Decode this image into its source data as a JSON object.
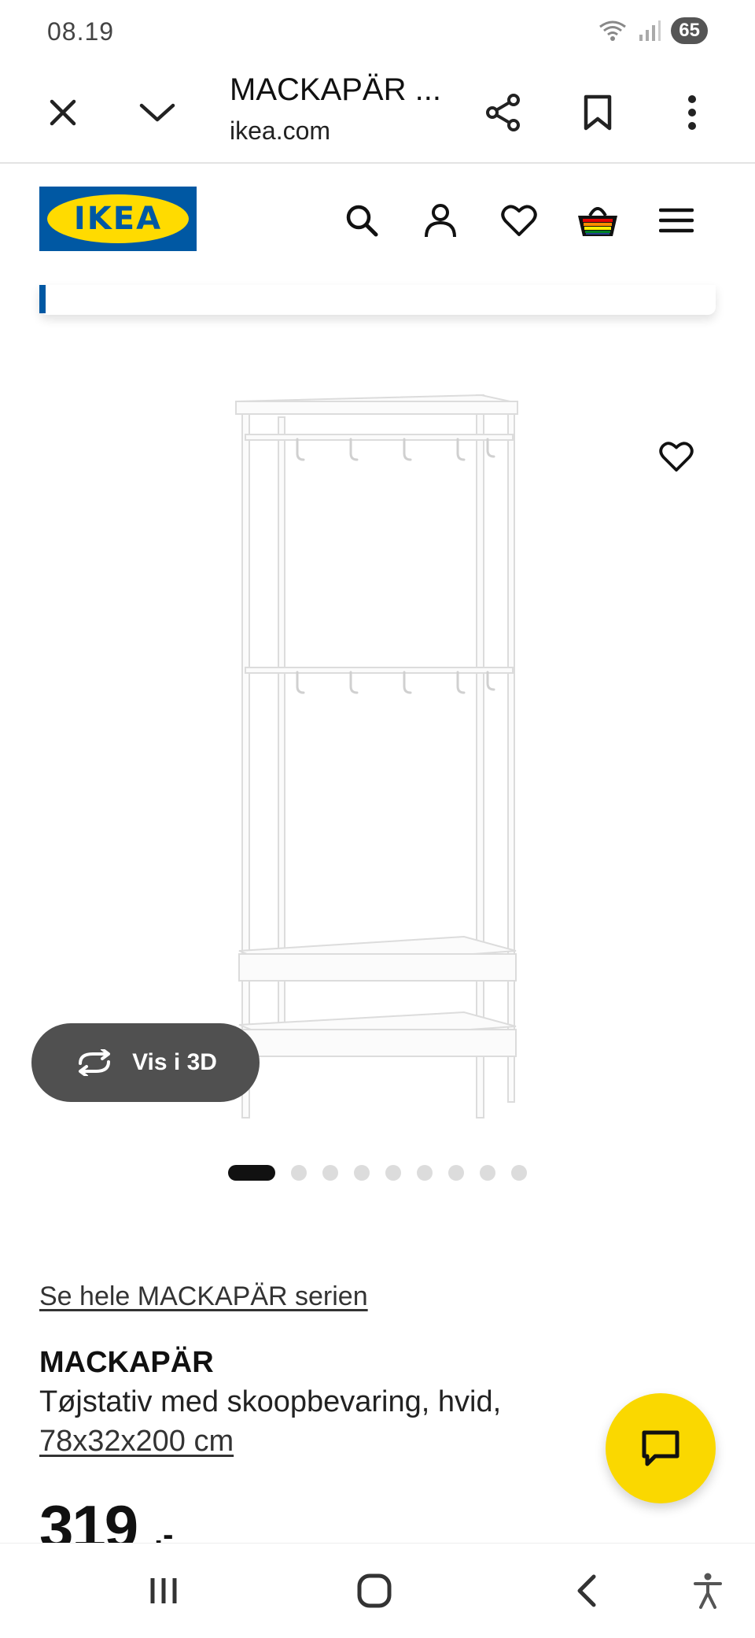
{
  "status_bar": {
    "time": "08.19",
    "battery": "65"
  },
  "browser": {
    "tab_title": "MACKAPÄR ...",
    "url": "ikea.com"
  },
  "ikea_header": {
    "logo_text": "IKEA"
  },
  "icons": {
    "close": "close-icon",
    "collapse": "chevron-down-icon",
    "share": "share-icon",
    "bookmark": "bookmark-icon",
    "more": "more-vertical-icon",
    "search": "search-icon",
    "profile": "user-icon",
    "favorites": "heart-icon",
    "basket": "basket-icon",
    "menu": "hamburger-menu-icon",
    "rotate3d": "rotate-3d-icon",
    "chat": "chat-icon",
    "recents": "recent-apps-icon",
    "home": "home-icon",
    "back": "back-icon",
    "accessibility": "accessibility-icon"
  },
  "product": {
    "view_3d_label": "Vis i 3D",
    "image_count": 9,
    "active_image": 1,
    "series_link": "Se hele MACKAPÄR serien",
    "name": "MACKAPÄR",
    "description": "Tøjstativ med skoopbevaring, hvid,",
    "size": "78x32x200 cm",
    "price": "319",
    "price_suffix": ",-"
  },
  "colors": {
    "ikea_blue": "#0058a3",
    "ikea_yellow": "#ffdb00",
    "chat_yellow": "#fad800"
  }
}
